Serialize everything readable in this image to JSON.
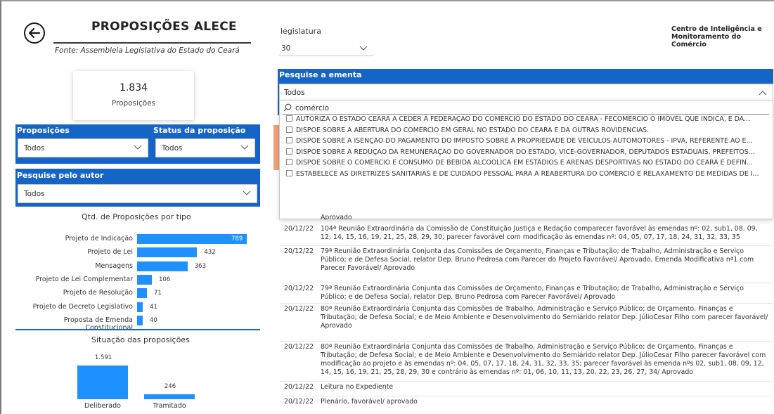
{
  "header": {
    "title": "PROPOSIÇÕES ALECE",
    "subtitle": "Fonte: Assembleia Legislativa do Estado do Ceará",
    "back_icon": "arrow-left-circle-icon"
  },
  "kpi": {
    "value": "1.834",
    "label": "Proposições"
  },
  "filters": {
    "proposicoes": {
      "label": "Proposições",
      "value": "Todos"
    },
    "status": {
      "label": "Status da proposição",
      "value": "Todos"
    },
    "autor": {
      "label": "Pesquise pelo autor",
      "value": "Todos"
    }
  },
  "bar_chart_title": "Qtd. de Proposições por tipo",
  "column_chart_title": "Situação das proposições",
  "chart_data": [
    {
      "type": "bar",
      "title": "Qtd. de Proposições por tipo",
      "categories": [
        "Projeto de Indicação",
        "Projeto de Lei",
        "Mensagens",
        "Projeto de Lei Complementar",
        "Projeto de Resolução",
        "Projeto de Decreto Legislativo",
        "Proposta de Emenda Constitucional"
      ],
      "values": [
        789,
        432,
        363,
        106,
        71,
        41,
        40
      ],
      "labels": [
        "789",
        "432",
        "363",
        "106",
        "71",
        "41",
        "40"
      ],
      "color": "#1e90ff",
      "orientation": "horizontal"
    },
    {
      "type": "bar",
      "title": "Situação das proposições",
      "categories": [
        "Deliberado",
        "Tramitado"
      ],
      "values": [
        1591,
        246
      ],
      "labels": [
        "1.591",
        "246"
      ],
      "color": "#1e90ff",
      "orientation": "vertical"
    }
  ],
  "legislatura": {
    "label": "legislatura",
    "value": "30"
  },
  "org": {
    "line1": "Centro de Inteligência e",
    "line2": "Monitoramento do Comércio"
  },
  "ementa": {
    "label": "Pesquise a ementa",
    "value": "Todos",
    "search_value": "comércio",
    "options": [
      "AUTORIZA O ESTADO CEARÁ A CEDER À FEDERAÇÃO DO COMÉRCIO DO ESTADO DO CEARÁ - FECOMERCIO O IMÓVEL QUE INDICA, E DÁ...",
      "DISPÕE SOBRE A ABERTURA DO COMÉRCIO EM GERAL NO ESTADO DO CEARÁ E DÁ OUTRAS ROVIDÊNCIAS.",
      "DISPÕE SOBRE A ISENÇÃO DO PAGAMENTO DO IMPOSTO SOBRE A PROPRIEDADE DE VEÍCULOS AUTOMOTORES - IPVA, REFERENTE AO E...",
      "DISPÕE SOBRE A REDUÇÃO DA REMUNERAÇÃO DO GOVERNADOR DO ESTADO, VICE-GOVERNADOR, DEPUTADOS ESTADUAIS, PREFEITOS...",
      "DISPÕE SOBRE O COMÉRCIO E CONSUMO DE BEBIDA ALCOÓLICA EM ESTÁDIOS E ARENAS DESPORTIVAS NO ESTADO DO CEARÁ E DEFIN...",
      "ESTABELECE AS DIRETRIZES SANITÁRIAS E DE CUIDADO PESSOAL PARA A REABERTURA DO COMÉRCIO E RELAXAMENTO DE MEDIDAS DE I..."
    ]
  },
  "history": {
    "partial_text": "Aprovado",
    "rows": [
      {
        "date": "20/12/22",
        "text": "104ª Reunião Extraordinária da Comissão de Constituição Justiça e Redação comparecer favorável às emendas nº: 02, sub1, 08, 09, 12, 14, 15, 16, 19, 21, 25, 28, 29, 30; parecer favorável com modificação às emendas nº: 04, 05, 07, 17, 18, 24, 31, 32, 33, 35"
      },
      {
        "date": "20/12/22",
        "text": "79ª Reunião Extraordinária Conjunta das Comissões de Orçamento, Finanças e Tributação; de Trabalho, Administração e Serviço Público; e de Defesa Social, relator Dep. Bruno Pedrosa com Parecer do Projeto Favorável/ Aprovado, Emenda Modificativa nª1 com Parecer Favorável/ Aprovado"
      },
      {
        "date": "20/12/22",
        "text": "79ª Reunião Extraordinária Conjunta das Comissões de Orçamento, Finanças e Tributação; de Trabalho, Administração e Serviço Público; e de Defesa Social, relator Dep. Bruno Pedrosa com Parecer Favorável/ Aprovado"
      },
      {
        "date": "20/12/22",
        "text": "80ª Reunião Extraordinária Conjunta das Comissões de Trabalho, Administração e Serviço Público; de Orçamento, Finanças e Tributação; de Defesa Social; e de Meio Ambiente e Desenvolvimento do Semiárido relator Dep. JúlioCesar Filho com parecer favorável/ Aprovado"
      },
      {
        "date": "20/12/22",
        "text": "80ª Reunião Extraordinária Conjunta das Comissões de Trabalho, Administração e Serviço Público; de Orçamento, Finanças e Tributação; de Defesa Social; e de Meio Ambiente e Desenvolvimento do Semiárido relator Dep. JúlioCesar Filho parecer favorável com modificação ao projeto e às emendas nº: 04, 05, 07, 17, 18, 24, 31, 32, 33, 35; parecer favorável às emenda nºs 02, sub1, 08, 09, 12, 14, 15, 16, 19, 21, 25, 28, 29, 30 e contrário às emendas nº: 01, 06, 10, 11, 13, 20, 22, 23, 26, 27, 34/ Aprovado"
      },
      {
        "date": "20/12/22",
        "text": "Leitura no Expediente"
      },
      {
        "date": "20/12/22",
        "text": "Plenário, favorável/ aprovado"
      }
    ]
  }
}
